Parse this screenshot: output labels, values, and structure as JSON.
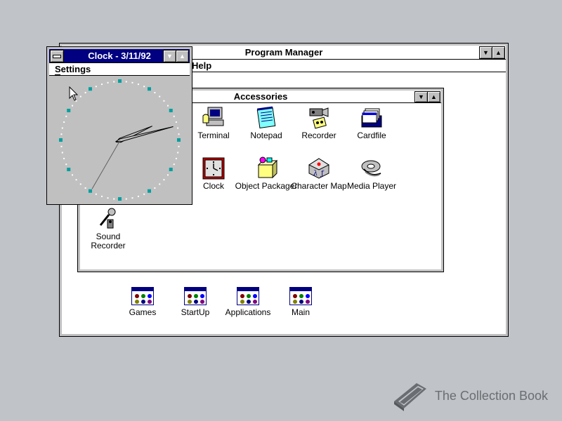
{
  "program_manager": {
    "title": "Program Manager",
    "menu": "Help"
  },
  "accessories": {
    "title": "Accessories",
    "icons": [
      {
        "label": "Terminal",
        "icon": "terminal-icon"
      },
      {
        "label": "Notepad",
        "icon": "notepad-icon"
      },
      {
        "label": "Recorder",
        "icon": "recorder-icon"
      },
      {
        "label": "Cardfile",
        "icon": "cardfile-icon"
      },
      {
        "label": "Clock",
        "icon": "clock-icon"
      },
      {
        "label": "Object Packager",
        "icon": "object-packager-icon"
      },
      {
        "label": "Character Map",
        "icon": "character-map-icon"
      },
      {
        "label": "Media Player",
        "icon": "media-player-icon"
      },
      {
        "label": "Sound Recorder",
        "icon": "sound-recorder-icon"
      }
    ]
  },
  "groups": [
    {
      "label": "Games"
    },
    {
      "label": "StartUp"
    },
    {
      "label": "Applications"
    },
    {
      "label": "Main"
    }
  ],
  "clock": {
    "title": "Clock - 3/11/92",
    "menu_settings": "Settings",
    "time_hours": 2,
    "time_minutes": 12,
    "time_seconds": 35
  },
  "watermark": {
    "text": "The Collection Book"
  },
  "colors": {
    "active_title": "#000080",
    "desktop": "#c0c4c8"
  }
}
